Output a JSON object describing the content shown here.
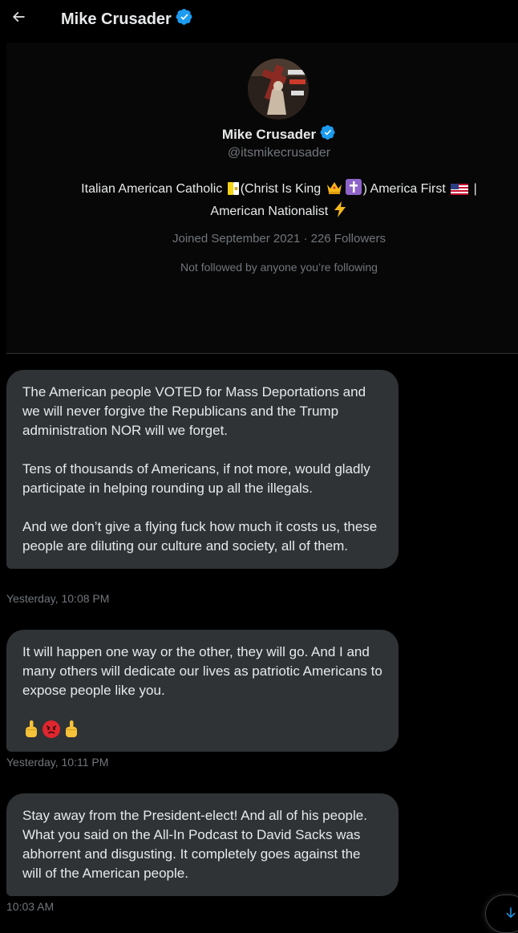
{
  "header": {
    "title": "Mike Crusader",
    "back_icon": "arrow-left-icon",
    "verified_icon": "verified-badge-icon"
  },
  "profile": {
    "name": "Mike Crusader",
    "handle": "@itsmikecrusader",
    "bio": {
      "part1": "Italian American Catholic",
      "part2": "(Christ Is King",
      "part3": ") America First",
      "part4": "|",
      "part5": "American Nationalist"
    },
    "joined": "Joined September 2021 · 226 Followers",
    "not_followed": "Not followed by anyone you’re following",
    "emojis": [
      "vatican-flag-icon",
      "crown-icon",
      "latin-cross-icon",
      "us-flag-icon",
      "lightning-icon"
    ]
  },
  "messages": [
    {
      "paragraphs": [
        "The American people VOTED for Mass Deportations and we will never  forgive the Republicans and the Trump administration NOR will we forget.",
        "Tens of thousands of Americans, if not more, would gladly participate in helping rounding up all the illegals.",
        "And we don’t give a flying fuck how much it costs us, these people are diluting our culture and society, all of them."
      ],
      "timestamp": "Yesterday, 10:08 PM"
    },
    {
      "paragraphs": [
        "It will happen one way or the other, they will go. And I and many others will dedicate our lives as patriotic Americans to expose people like you."
      ],
      "emojis": [
        "middle-finger-icon",
        "angry-face-icon",
        "middle-finger-icon"
      ],
      "timestamp": "Yesterday, 10:11 PM"
    },
    {
      "paragraphs": [
        "Stay away from the President-elect! And all of his people. What you said on the All-In Podcast to David Sacks was abhorrent and disgusting. It completely goes against the will of the American people."
      ],
      "timestamp": "10:03 AM"
    }
  ],
  "scroll_button": {
    "icon": "arrow-down-icon"
  },
  "colors": {
    "background": "#000000",
    "bubble": "#2f3336",
    "text": "#e7e9ea",
    "secondary_text": "#71767b",
    "accent": "#1d9bf0"
  }
}
